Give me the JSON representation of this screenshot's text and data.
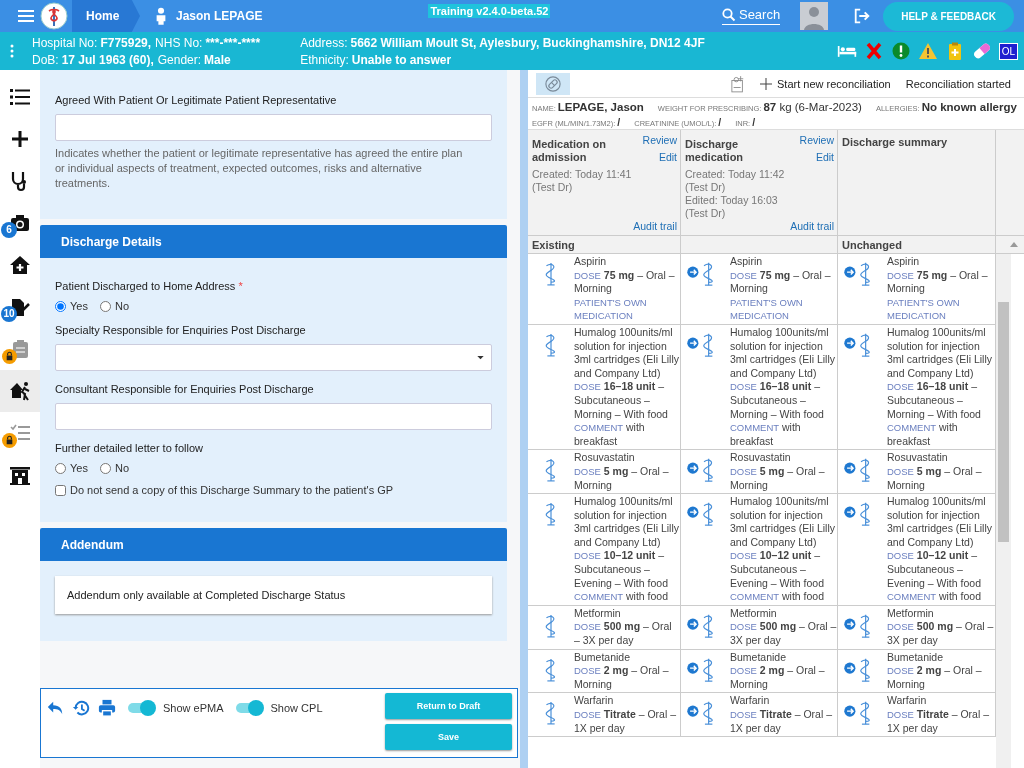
{
  "top_bar": {
    "home": "Home",
    "patient": "Jason LEPAGE",
    "version": "Training v2.4.0-beta.52",
    "search": "Search",
    "help": "HELP & FEEDBACK"
  },
  "banner": {
    "lines": [
      [
        {
          "label": "Hospital No:",
          "value": "F775929,"
        },
        {
          "label": "NHS No:",
          "value": "***-***-****"
        }
      ],
      [
        {
          "label": "DoB:",
          "value": "17 Jul 1963 (60),"
        },
        {
          "label": "Gender:",
          "value": "Male"
        }
      ]
    ],
    "address": [
      {
        "label": "Address:",
        "value": "5662 William Moult St, Aylesbury, Buckinghamshire, DN12 4JF"
      },
      {
        "label": "Ethnicity:",
        "value": "Unable to answer"
      }
    ],
    "alerts": [
      {
        "kind": "bed"
      },
      {
        "kind": "cross"
      },
      {
        "kind": "exclaim"
      },
      {
        "kind": "warning"
      },
      {
        "kind": "clipboard"
      },
      {
        "kind": "pill"
      },
      {
        "kind": "text",
        "text": "OL"
      }
    ]
  },
  "sidebar": [
    {
      "kind": "list",
      "selected": false,
      "locked": false
    },
    {
      "kind": "plus",
      "selected": false,
      "locked": false
    },
    {
      "kind": "stethoscope",
      "selected": false,
      "locked": false
    },
    {
      "kind": "camera",
      "selected": false,
      "locked": false,
      "badge": "6"
    },
    {
      "kind": "house",
      "selected": false,
      "locked": false
    },
    {
      "kind": "document",
      "selected": false,
      "locked": false,
      "badge": "10"
    },
    {
      "kind": "clipboard",
      "selected": false,
      "locked": true
    },
    {
      "kind": "house-person",
      "selected": true,
      "locked": false
    },
    {
      "kind": "checklist",
      "selected": false,
      "locked": true
    },
    {
      "kind": "building",
      "selected": false,
      "locked": false
    }
  ],
  "form": {
    "top_field": {
      "label": "Agreed With Patient Or Legitimate Patient Representative",
      "hint": "Indicates whether the patient or legitimate representative has agreed the entire plan or individual aspects of treatment, expected outcomes, risks and alternative treatments."
    },
    "discharge": {
      "title": "Discharge Details",
      "fields": [
        {
          "kind": "radio",
          "label": "Patient Discharged to Home Address",
          "required_mark": "*",
          "options": [
            {
              "label": "Yes",
              "selected": true
            },
            {
              "label": "No",
              "selected": false
            }
          ]
        },
        {
          "kind": "select",
          "label": "Specialty Responsible for Enquiries Post Discharge"
        },
        {
          "kind": "text",
          "label": "Consultant Responsible for Enquiries Post Discharge"
        },
        {
          "kind": "radio",
          "label": "Further detailed letter to follow",
          "options": [
            {
              "label": "Yes",
              "selected": false
            },
            {
              "label": "No",
              "selected": false
            }
          ]
        },
        {
          "kind": "checkbox",
          "label": "Do not send a copy of this Discharge Summary to the patient's GP",
          "checked": false
        }
      ]
    },
    "addendum": {
      "title": "Addendum",
      "message": "Addendum only available at Completed Discharge Status"
    }
  },
  "footer": {
    "toggles": [
      {
        "label": "Show ePMA",
        "on": true
      },
      {
        "label": "Show CPL",
        "on": true
      }
    ],
    "buttons": [
      "Return to Draft",
      "Save"
    ]
  },
  "reconciliation": {
    "toolbar": {
      "pill_selected": true,
      "start": "Start new reconciliation",
      "status": "Reconciliation started"
    },
    "info": [
      [
        {
          "label": "NAME:",
          "value": "**LEPAGE, Jason**"
        },
        {
          "label": "WEIGHT FOR PRESCRIBING:",
          "value": "**87** kg (6-Mar-2023)"
        },
        {
          "label": "ALLERGIES:",
          "value": "**No known allergy**"
        }
      ],
      [
        {
          "label": "EGFR (ML/MIN/1.73M2):",
          "value": "**/**"
        },
        {
          "label": "CREATININE (UMOL/L):",
          "value": "**/**"
        },
        {
          "label": "INR:",
          "value": "**/**"
        }
      ]
    ],
    "columns": [
      {
        "title": "Medication on admission",
        "links": [
          "Review",
          "Edit"
        ],
        "meta": [
          "Created: Today 11:41",
          "(Test Dr)"
        ],
        "audit": "Audit trail",
        "status": "Existing"
      },
      {
        "title": "Discharge medication",
        "links": [
          "Review",
          "Edit"
        ],
        "meta": [
          "Created: Today 11:42",
          "(Test Dr)",
          "Edited: Today 16:03",
          "(Test Dr)"
        ],
        "audit": "Audit trail"
      },
      {
        "title": "Discharge summary",
        "status": "Unchanged"
      }
    ],
    "rows": [
      [
        {
          "kind": "existing",
          "name": "Aspirin",
          "dose_label": "DOSE",
          "dose": "**75 mg** – Oral – Morning",
          "notes": [
            {
              "label": "PATIENT'S OWN MEDICATION"
            }
          ]
        },
        {
          "kind": "carried",
          "name": "Aspirin",
          "dose_label": "DOSE",
          "dose": "**75 mg** – Oral – Morning",
          "notes": [
            {
              "label": "PATIENT'S OWN MEDICATION"
            }
          ]
        },
        {
          "kind": "carried",
          "name": "Aspirin",
          "dose_label": "DOSE",
          "dose": "**75 mg** – Oral – Morning",
          "notes": [
            {
              "label": "PATIENT'S OWN MEDICATION"
            }
          ]
        }
      ],
      [
        {
          "kind": "existing",
          "name": "Humalog 100units/ml solution for injection 3ml cartridges (Eli Lilly and Company Ltd)",
          "dose_label": "DOSE",
          "dose": "**16–18 unit** – Subcutaneous – Morning – With food",
          "notes": [
            {
              "label": "COMMENT",
              "text": "with breakfast"
            }
          ]
        },
        {
          "kind": "carried",
          "name": "Humalog 100units/ml solution for injection 3ml cartridges (Eli Lilly and Company Ltd)",
          "dose_label": "DOSE",
          "dose": "**16–18 unit** – Subcutaneous – Morning – With food",
          "notes": [
            {
              "label": "COMMENT",
              "text": "with breakfast"
            }
          ]
        },
        {
          "kind": "carried",
          "name": "Humalog 100units/ml solution for injection 3ml cartridges (Eli Lilly and Company Ltd)",
          "dose_label": "DOSE",
          "dose": "**16–18 unit** – Subcutaneous – Morning – With food",
          "notes": [
            {
              "label": "COMMENT",
              "text": "with breakfast"
            }
          ]
        }
      ],
      [
        {
          "kind": "existing",
          "name": "Rosuvastatin",
          "dose_label": "DOSE",
          "dose": "**5 mg** – Oral – Morning"
        },
        {
          "kind": "carried",
          "name": "Rosuvastatin",
          "dose_label": "DOSE",
          "dose": "**5 mg** – Oral – Morning"
        },
        {
          "kind": "carried",
          "name": "Rosuvastatin",
          "dose_label": "DOSE",
          "dose": "**5 mg** – Oral – Morning"
        }
      ],
      [
        {
          "kind": "existing",
          "name": "Humalog 100units/ml solution for injection 3ml cartridges (Eli Lilly and Company Ltd)",
          "dose_label": "DOSE",
          "dose": "**10–12 unit** – Subcutaneous – Evening – With food",
          "notes": [
            {
              "label": "COMMENT",
              "text": "with food"
            }
          ]
        },
        {
          "kind": "carried",
          "name": "Humalog 100units/ml solution for injection 3ml cartridges (Eli Lilly and Company Ltd)",
          "dose_label": "DOSE",
          "dose": "**10–12 unit** – Subcutaneous – Evening – With food",
          "notes": [
            {
              "label": "COMMENT",
              "text": "with food"
            }
          ]
        },
        {
          "kind": "carried",
          "name": "Humalog 100units/ml solution for injection 3ml cartridges (Eli Lilly and Company Ltd)",
          "dose_label": "DOSE",
          "dose": "**10–12 unit** – Subcutaneous – Evening – With food",
          "notes": [
            {
              "label": "COMMENT",
              "text": "with food"
            }
          ]
        }
      ],
      [
        {
          "kind": "existing",
          "name": "Metformin",
          "dose_label": "DOSE",
          "dose": "**500 mg** – Oral – 3X per day"
        },
        {
          "kind": "carried",
          "name": "Metformin",
          "dose_label": "DOSE",
          "dose": "**500 mg** – Oral – 3X per day"
        },
        {
          "kind": "carried",
          "name": "Metformin",
          "dose_label": "DOSE",
          "dose": "**500 mg** – Oral – 3X per day"
        }
      ],
      [
        {
          "kind": "existing",
          "name": "Bumetanide",
          "dose_label": "DOSE",
          "dose": "**2 mg** – Oral – Morning"
        },
        {
          "kind": "carried",
          "name": "Bumetanide",
          "dose_label": "DOSE",
          "dose": "**2 mg** – Oral – Morning"
        },
        {
          "kind": "carried",
          "name": "Bumetanide",
          "dose_label": "DOSE",
          "dose": "**2 mg** – Oral – Morning"
        }
      ],
      [
        {
          "kind": "existing",
          "name": "Warfarin",
          "dose_label": "DOSE",
          "dose": "**Titrate** – Oral – 1X per day"
        },
        {
          "kind": "carried",
          "name": "Warfarin",
          "dose_label": "DOSE",
          "dose": "**Titrate** – Oral – 1X per day"
        },
        {
          "kind": "carried",
          "name": "Warfarin",
          "dose_label": "DOSE",
          "dose": "**Titrate** – Oral – 1X per day"
        }
      ]
    ]
  }
}
